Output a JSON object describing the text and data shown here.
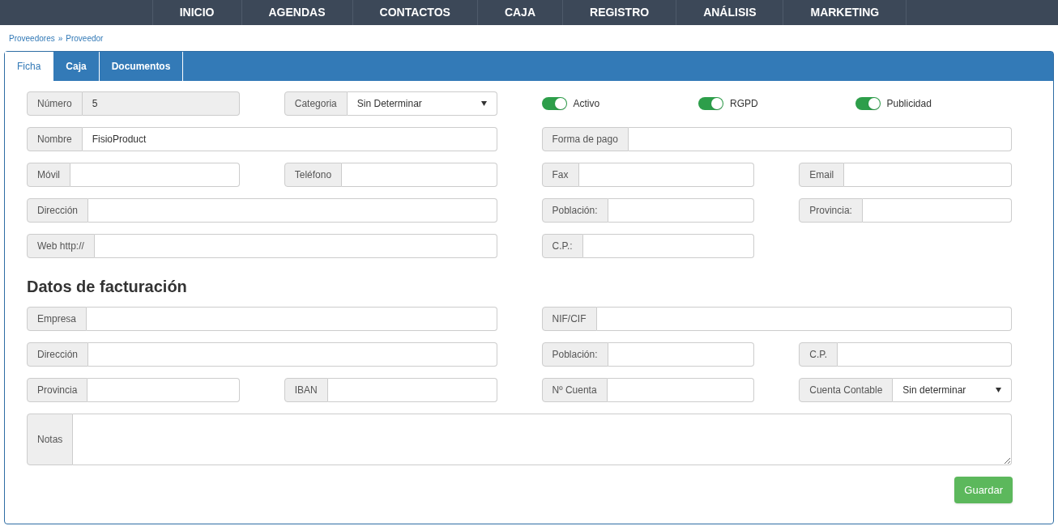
{
  "nav": {
    "items": [
      {
        "label": "INICIO",
        "selected": false
      },
      {
        "label": "AGENDAS",
        "selected": false
      },
      {
        "label": "CONTACTOS",
        "selected": false
      },
      {
        "label": "CAJA",
        "selected": false
      },
      {
        "label": "REGISTRO",
        "selected": false
      },
      {
        "label": "ANÁLISIS",
        "selected": false
      },
      {
        "label": "MARKETING",
        "selected": false
      }
    ]
  },
  "breadcrumb": [
    "Proveedores",
    "»",
    "Proveedor"
  ],
  "tabs": [
    {
      "label": "Ficha",
      "selected": true
    },
    {
      "label": "Caja",
      "selected": false
    },
    {
      "label": "Documentos",
      "selected": false
    }
  ],
  "form": {
    "fields": [
      {
        "kind": "input",
        "label": "Número",
        "value": "5",
        "disabled": true
      },
      {
        "kind": "select",
        "label": "Categoria",
        "value": "Sin Determinar"
      },
      {
        "kind": "toggles",
        "items": [
          {
            "label": "Activo",
            "on": true
          },
          {
            "label": "RGPD",
            "on": true
          },
          {
            "label": "Publicidad",
            "on": true
          }
        ]
      },
      {
        "kind": "input",
        "label": "Nombre",
        "value": "FisioProduct",
        "disabled": false
      },
      {
        "kind": "input",
        "label": "Forma de pago",
        "disabled": false
      },
      {
        "kind": "input",
        "label": "Móvil",
        "disabled": false
      },
      {
        "kind": "input",
        "label": "Teléfono",
        "disabled": false
      },
      {
        "kind": "input",
        "label": "Fax",
        "disabled": false
      },
      {
        "kind": "input",
        "label": "Email",
        "disabled": false
      },
      {
        "kind": "input",
        "label": "Dirección",
        "disabled": false
      },
      {
        "kind": "input",
        "label": "Población:",
        "disabled": false
      },
      {
        "kind": "input",
        "label": "Provincia:",
        "disabled": false
      },
      {
        "kind": "input",
        "label": "Web http://",
        "disabled": false
      },
      {
        "kind": "input",
        "label": "C.P.:",
        "disabled": false
      }
    ],
    "billing_title": "Datos de facturación",
    "billing_fields": [
      {
        "kind": "input",
        "label": "Empresa",
        "disabled": false
      },
      {
        "kind": "input",
        "label": "NIF/CIF",
        "disabled": false
      },
      {
        "kind": "input",
        "label": "Dirección",
        "disabled": false
      },
      {
        "kind": "input",
        "label": "Población:",
        "disabled": false
      },
      {
        "kind": "input",
        "label": "C.P.",
        "disabled": false
      },
      {
        "kind": "input",
        "label": "Provincia",
        "disabled": false
      },
      {
        "kind": "input",
        "label": "IBAN",
        "disabled": false
      },
      {
        "kind": "input",
        "label": "Nº Cuenta",
        "disabled": false
      },
      {
        "kind": "select",
        "label": "Cuenta Contable",
        "value": "Sin determinar"
      },
      {
        "kind": "textarea",
        "label": "Notas"
      }
    ],
    "save_button": "Guardar"
  }
}
